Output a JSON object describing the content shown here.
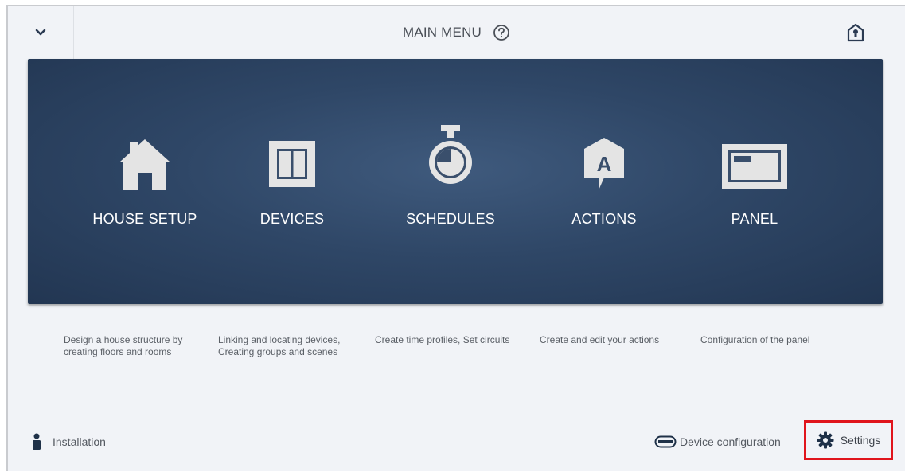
{
  "header": {
    "title": "MAIN MENU"
  },
  "tiles": [
    {
      "label": "HOUSE SETUP",
      "icon": "house-icon",
      "description": "Design a house structure by creating floors and rooms"
    },
    {
      "label": "DEVICES",
      "icon": "switch-icon",
      "description": "Linking and locating devices, Creating groups and scenes"
    },
    {
      "label": "SCHEDULES",
      "icon": "timer-icon",
      "description": "Create time profiles, Set circuits"
    },
    {
      "label": "ACTIONS",
      "icon": "action-icon",
      "description": "Create and edit your actions"
    },
    {
      "label": "PANEL",
      "icon": "panel-icon",
      "description": "Configuration of the panel"
    }
  ],
  "footer": {
    "installation": "Installation",
    "device_configuration": "Device configuration",
    "settings": "Settings"
  },
  "colors": {
    "panel_bg": "#2f4767",
    "highlight": "#e0141c",
    "icon_light": "#e6e6e6"
  }
}
